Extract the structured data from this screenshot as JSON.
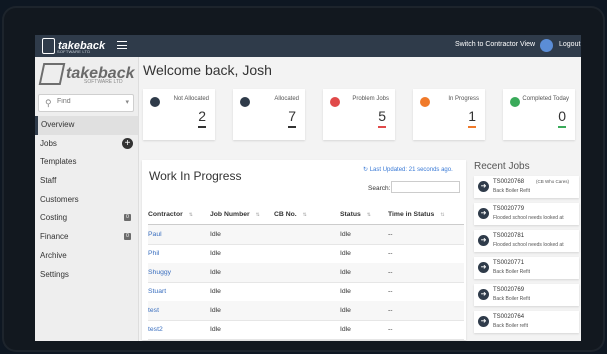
{
  "topbar": {
    "logo": "takeback",
    "logo_sub": "SOFTWARE LTD",
    "switch_view": "Switch to Contractor View",
    "logout": "Logout"
  },
  "sidebar": {
    "logo": "takeback",
    "logo_sub": "SOFTWARE LTD",
    "find_placeholder": "Find",
    "items": [
      {
        "label": "Overview"
      },
      {
        "label": "Jobs"
      },
      {
        "label": "Templates"
      },
      {
        "label": "Staff"
      },
      {
        "label": "Customers"
      },
      {
        "label": "Costing",
        "badge": "0"
      },
      {
        "label": "Finance",
        "badge": "0"
      },
      {
        "label": "Archive"
      },
      {
        "label": "Settings"
      }
    ]
  },
  "welcome": "Welcome back, Josh",
  "cards": [
    {
      "label": "Not Allocated",
      "value": "2",
      "color": "#333333"
    },
    {
      "label": "Allocated",
      "value": "7",
      "color": "#333333"
    },
    {
      "label": "Problem Jobs",
      "value": "5",
      "color": "#e04a4a"
    },
    {
      "label": "In Progress",
      "value": "1",
      "color": "#f07a2a"
    },
    {
      "label": "Completed Today",
      "value": "0",
      "color": "#3aaa5a"
    }
  ],
  "wip": {
    "title": "Work In Progress",
    "last_updated": "Last Updated: 21 seconds ago.",
    "search_label": "Search:",
    "columns": [
      "Contractor",
      "Job Number",
      "CB No.",
      "Status",
      "Time in Status"
    ],
    "rows": [
      {
        "contractor": "Paul",
        "job": "Idle",
        "cb": "",
        "status": "Idle",
        "time": "--"
      },
      {
        "contractor": "Phil",
        "job": "Idle",
        "cb": "",
        "status": "Idle",
        "time": "--"
      },
      {
        "contractor": "Shuggy",
        "job": "Idle",
        "cb": "",
        "status": "Idle",
        "time": "--"
      },
      {
        "contractor": "Stuart",
        "job": "Idle",
        "cb": "",
        "status": "Idle",
        "time": "--"
      },
      {
        "contractor": "test",
        "job": "Idle",
        "cb": "",
        "status": "Idle",
        "time": "--"
      },
      {
        "contractor": "test2",
        "job": "Idle",
        "cb": "",
        "status": "Idle",
        "time": "--"
      }
    ]
  },
  "recent": {
    "title": "Recent Jobs",
    "items": [
      {
        "number": "TS0020768",
        "extra": "(CB Who Cares)",
        "desc": "Back Boiler Refit"
      },
      {
        "number": "TS0020779",
        "extra": "",
        "desc": "Flooded school needs looked at"
      },
      {
        "number": "TS0020781",
        "extra": "",
        "desc": "Flooded school needs looked at"
      },
      {
        "number": "TS0020771",
        "extra": "",
        "desc": "Back Boiler Refit"
      },
      {
        "number": "TS0020769",
        "extra": "",
        "desc": "Back Boiler Refit"
      },
      {
        "number": "TS0020764",
        "extra": "",
        "desc": "Back Boiler refit"
      }
    ]
  }
}
